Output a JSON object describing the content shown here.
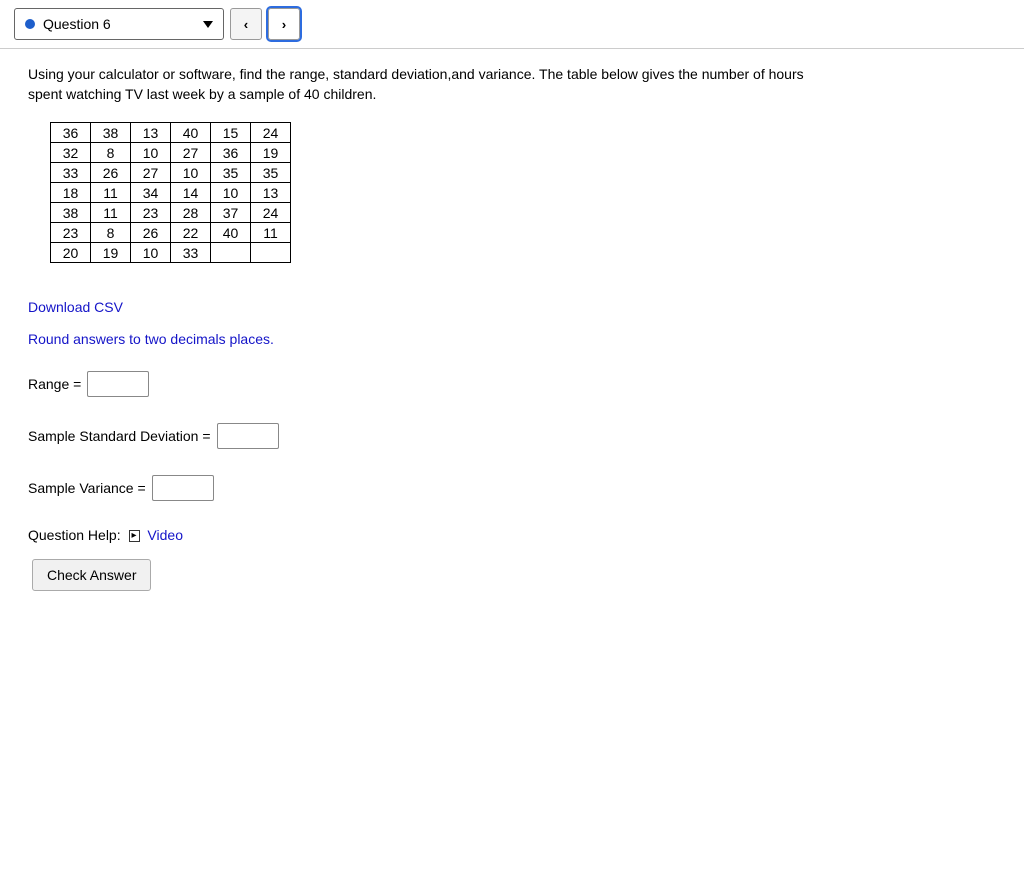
{
  "header": {
    "question_label": "Question 6",
    "prev_symbol": "‹",
    "next_symbol": "›"
  },
  "prompt": "Using your calculator or software, find the range, standard deviation,and variance. The table below gives the number of hours spent watching TV last week by a sample of 40 children.",
  "table": {
    "rows": [
      [
        "36",
        "38",
        "13",
        "40",
        "15",
        "24"
      ],
      [
        "32",
        "8",
        "10",
        "27",
        "36",
        "19"
      ],
      [
        "33",
        "26",
        "27",
        "10",
        "35",
        "35"
      ],
      [
        "18",
        "11",
        "34",
        "14",
        "10",
        "13"
      ],
      [
        "38",
        "11",
        "23",
        "28",
        "37",
        "24"
      ],
      [
        "23",
        "8",
        "26",
        "22",
        "40",
        "11"
      ],
      [
        "20",
        "19",
        "10",
        "33",
        "",
        ""
      ]
    ]
  },
  "download_label": "Download CSV",
  "hint": "Round answers to two decimals places.",
  "answers": {
    "range_label": "Range =",
    "sd_label": "Sample Standard Deviation =",
    "var_label": "Sample Variance ="
  },
  "help": {
    "label": "Question Help:",
    "video_icon": "▸",
    "video_label": "Video"
  },
  "check_label": "Check Answer"
}
